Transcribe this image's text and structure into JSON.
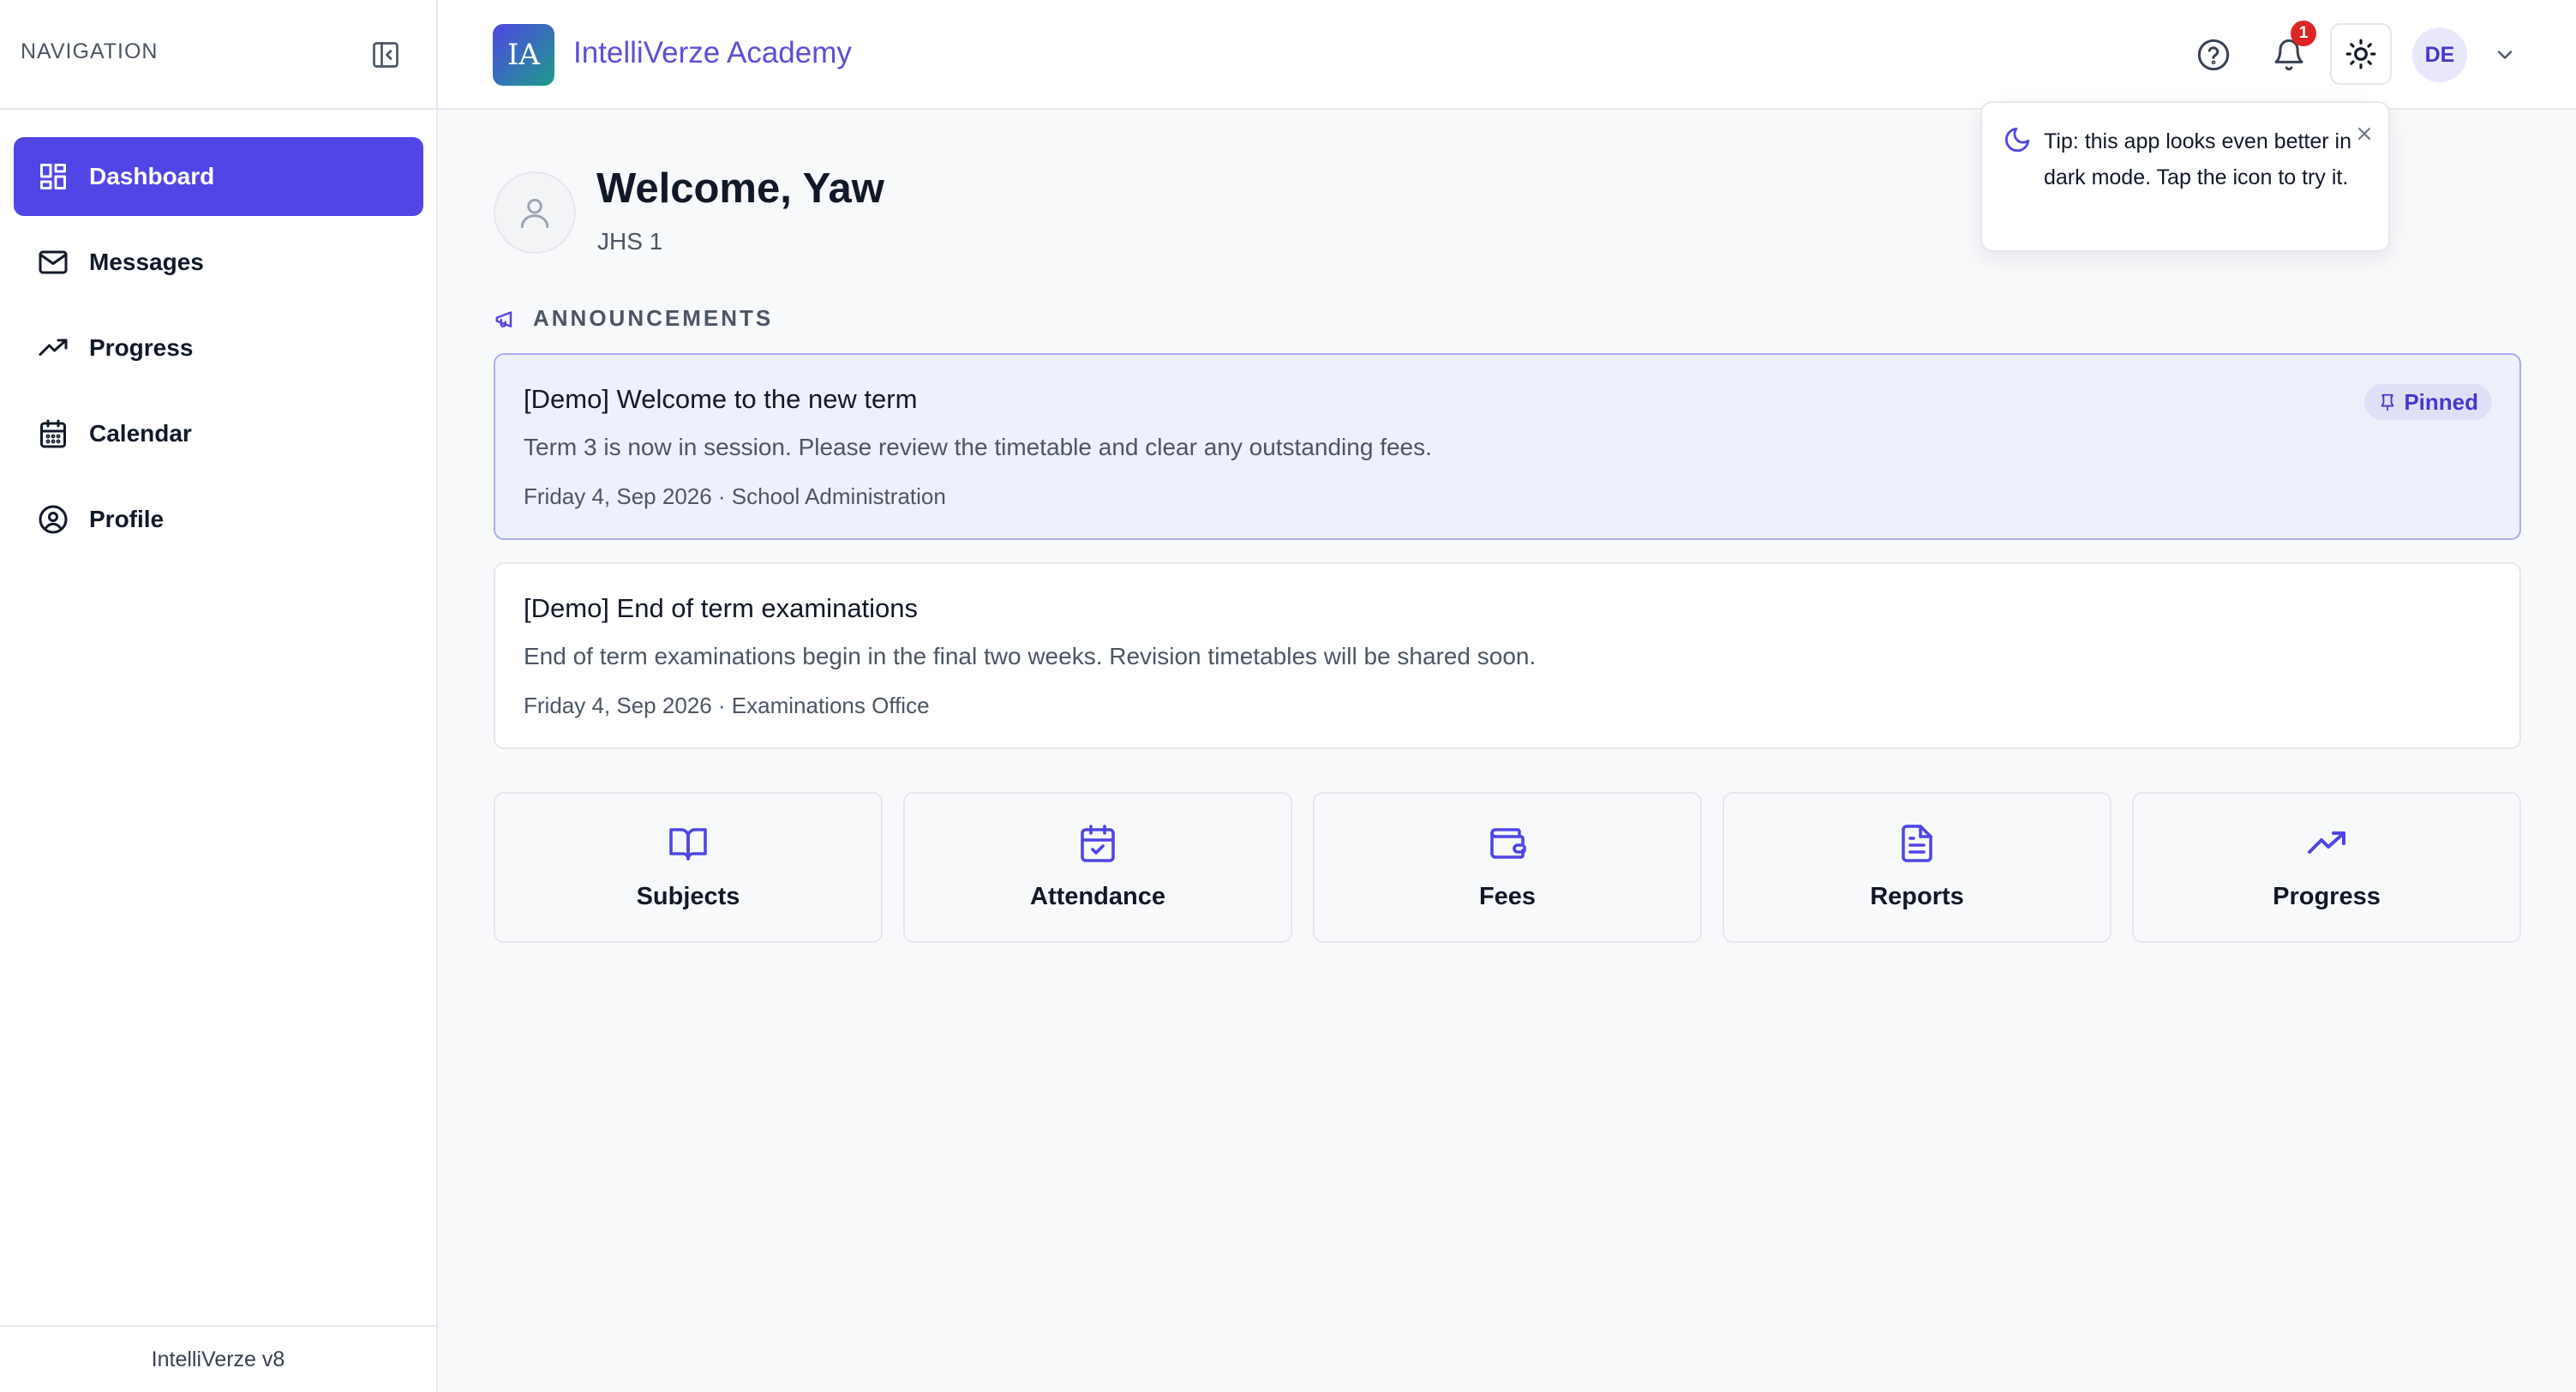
{
  "sidebar": {
    "heading": "NAVIGATION",
    "items": [
      {
        "label": "Dashboard",
        "icon": "dashboard-icon",
        "active": true
      },
      {
        "label": "Messages",
        "icon": "mail-icon"
      },
      {
        "label": "Progress",
        "icon": "trending-up-icon"
      },
      {
        "label": "Calendar",
        "icon": "calendar-icon"
      },
      {
        "label": "Profile",
        "icon": "user-circle-icon"
      }
    ],
    "footer": "IntelliVerze v8"
  },
  "header": {
    "logo_text": "IA",
    "brand": "IntelliVerze Academy",
    "notification_count": "1",
    "avatar_initials": "DE"
  },
  "tip": {
    "text": "Tip: this app looks even better in dark mode. Tap the icon to try it."
  },
  "profile": {
    "welcome": "Welcome, Yaw",
    "class": "JHS 1"
  },
  "announcements": {
    "heading": "ANNOUNCEMENTS",
    "items": [
      {
        "title": "[Demo] Welcome to the new term",
        "body": "Term 3 is now in session. Please review the timetable and clear any outstanding fees.",
        "meta": "Friday 4, Sep 2026 · School Administration",
        "badge": "Pinned"
      },
      {
        "title": "[Demo] End of term examinations",
        "body": "End of term examinations begin in the final two weeks. Revision timetables will be shared soon.",
        "meta": "Friday 4, Sep 2026 · Examinations Office"
      }
    ]
  },
  "tiles": [
    {
      "label": "Subjects",
      "icon": "book-open-icon"
    },
    {
      "label": "Attendance",
      "icon": "calendar-check-icon"
    },
    {
      "label": "Fees",
      "icon": "wallet-icon"
    },
    {
      "label": "Reports",
      "icon": "document-icon"
    },
    {
      "label": "Progress",
      "icon": "trending-up-icon"
    }
  ],
  "colors": {
    "accent": "#5146e5",
    "brand_text": "#5b4fd6",
    "badge_red": "#dc2626",
    "pinned_bg": "#eef0fb"
  }
}
